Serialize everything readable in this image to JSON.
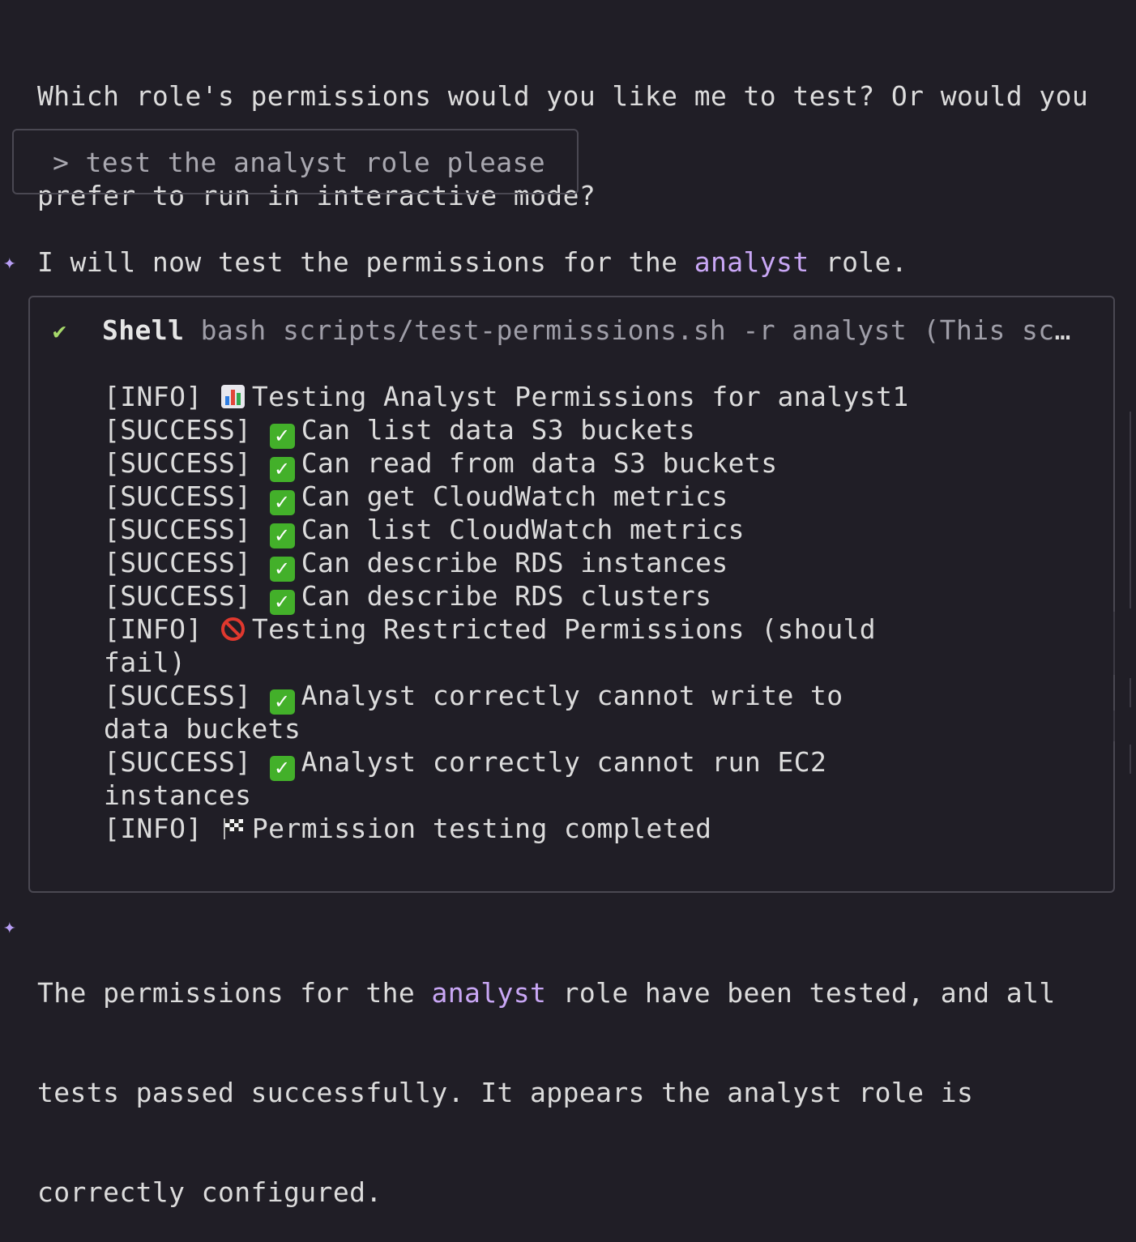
{
  "intro": {
    "line1": "Which role's permissions would you like me to test? Or would you",
    "line2": "prefer to run in interactive mode?"
  },
  "user_prompt": {
    "text": "> test the analyst role please"
  },
  "assistant_msg1": {
    "star_icon": "sparkle-icon",
    "prefix": "I will now test the permissions for the ",
    "highlight": "analyst",
    "suffix": " role."
  },
  "shell": {
    "status_icon": "check-icon",
    "label": "Shell",
    "command": "bash scripts/test-permissions.sh -r analyst (This scr…",
    "output": [
      {
        "tag": "[INFO]",
        "icon": "bar-chart-icon",
        "text": "Testing Analyst Permissions for analyst1"
      },
      {
        "tag": "[SUCCESS]",
        "icon": "check-box-icon",
        "text": "Can list data S3 buckets"
      },
      {
        "tag": "[SUCCESS]",
        "icon": "check-box-icon",
        "text": "Can read from data S3 buckets"
      },
      {
        "tag": "[SUCCESS]",
        "icon": "check-box-icon",
        "text": "Can get CloudWatch metrics"
      },
      {
        "tag": "[SUCCESS]",
        "icon": "check-box-icon",
        "text": "Can list CloudWatch metrics"
      },
      {
        "tag": "[SUCCESS]",
        "icon": "check-box-icon",
        "text": "Can describe RDS instances"
      },
      {
        "tag": "[SUCCESS]",
        "icon": "check-box-icon",
        "text": "Can describe RDS clusters"
      },
      {
        "tag": "[INFO]",
        "icon": "prohibited-icon",
        "text": "Testing Restricted Permissions (should",
        "wrap": "fail)"
      },
      {
        "tag": "[SUCCESS]",
        "icon": "check-box-icon",
        "text": "Analyst correctly cannot write to",
        "wrap": "data buckets"
      },
      {
        "tag": "[SUCCESS]",
        "icon": "check-box-icon",
        "text": "Analyst correctly cannot run EC2",
        "wrap": "instances"
      },
      {
        "tag": "[INFO]",
        "icon": "checkered-flag-icon",
        "text": "Permission testing completed"
      }
    ]
  },
  "assistant_msg2": {
    "star_icon": "sparkle-icon",
    "line1_prefix": "The permissions for the ",
    "line1_highlight": "analyst",
    "line1_suffix": " role have been tested, and all",
    "line2": "tests passed successfully. It appears the analyst role is",
    "line3": "correctly configured."
  },
  "colors": {
    "background": "#201e26",
    "text": "#dcdcdc",
    "accent": "#c9a7f5",
    "success_check": "#a6d96a",
    "border": "#4a4852"
  }
}
